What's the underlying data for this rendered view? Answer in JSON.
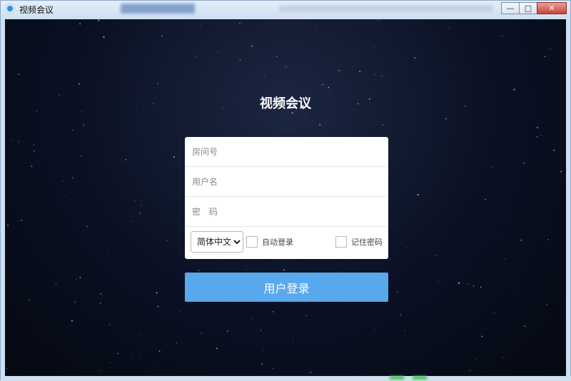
{
  "window": {
    "title": "视频会议",
    "controls": {
      "minimize": "—",
      "maximize": "□",
      "close": "✕"
    }
  },
  "main": {
    "heading": "视频会议",
    "fields": {
      "room": {
        "placeholder": "房间号",
        "value": ""
      },
      "username": {
        "placeholder": "用户名",
        "value": ""
      },
      "password": {
        "placeholder": "密　码",
        "value": ""
      }
    },
    "language": {
      "selected": "简体中文"
    },
    "auto_login": {
      "label": "自动登录",
      "checked": false
    },
    "remember_password": {
      "label": "记住密码",
      "checked": false
    },
    "login_button": "用户登录"
  },
  "colors": {
    "accent": "#58a8ee",
    "background": "#0a1023",
    "title_bar": "#cfe0f1"
  },
  "icons": [
    "app-logo-icon",
    "minimize-icon",
    "maximize-icon",
    "close-icon",
    "chevron-down-icon"
  ]
}
